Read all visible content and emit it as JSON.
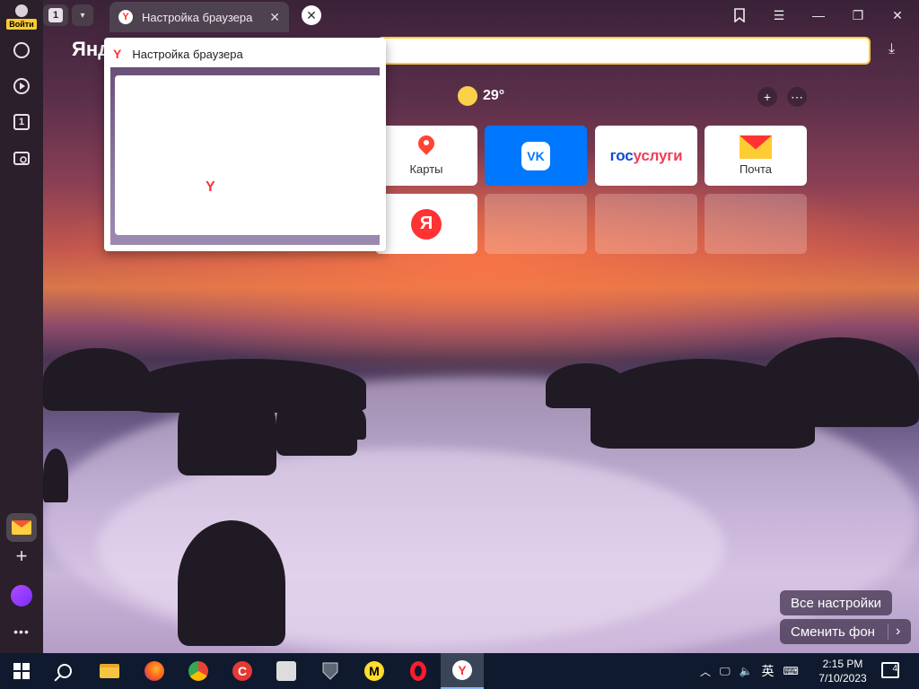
{
  "sidebar": {
    "login_label": "Войти",
    "tab_count": "1"
  },
  "tabstrip": {
    "tab_count": "1",
    "active_tab_title": "Настройка браузера",
    "active_tab_icon": "yandex-y-icon"
  },
  "address": {
    "brand": "Янд",
    "value": ""
  },
  "preview": {
    "title": "Настройка браузера",
    "logo": "Y"
  },
  "weather": {
    "temperature": "29°"
  },
  "tiles": {
    "maps_label": "Карты",
    "gosuslugi_a": "гос",
    "gosuslugi_b": "услуги",
    "mail_label": "Почта",
    "vk_logo": "VK",
    "ya_logo": "Я"
  },
  "buttons": {
    "all_settings": "Все настройки",
    "change_bg": "Сменить фон"
  },
  "taskbar": {
    "time": "2:15 PM",
    "date": "7/10/2023",
    "ime": "英",
    "notifications": "4"
  },
  "colors": {
    "accent": "#ffcc33",
    "yandex_red": "#ff3333",
    "vk_blue": "#0077ff"
  }
}
